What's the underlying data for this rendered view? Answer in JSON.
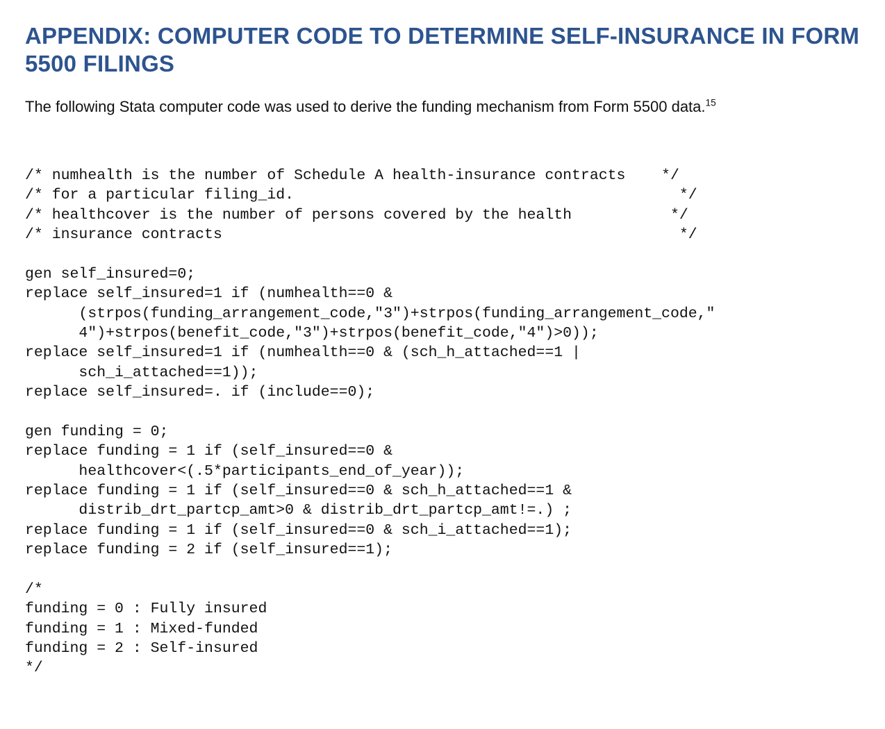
{
  "heading": "APPENDIX: COMPUTER CODE TO DETERMINE SELF-INSURANCE IN FORM 5500 FILINGS",
  "intro_text": "The following Stata computer code was used to derive the funding mechanism from Form 5500 data.",
  "footnote_marker": "15",
  "code_block": "/* numhealth is the number of Schedule A health-insurance contracts    */\n/* for a particular filing_id.                                           */\n/* healthcover is the number of persons covered by the health           */\n/* insurance contracts                                                   */\n\ngen self_insured=0;\nreplace self_insured=1 if (numhealth==0 &\n      (strpos(funding_arrangement_code,\"3\")+strpos(funding_arrangement_code,\"\n      4\")+strpos(benefit_code,\"3\")+strpos(benefit_code,\"4\")>0));\nreplace self_insured=1 if (numhealth==0 & (sch_h_attached==1 |\n      sch_i_attached==1));\nreplace self_insured=. if (include==0);\n\ngen funding = 0;\nreplace funding = 1 if (self_insured==0 &\n      healthcover<(.5*participants_end_of_year));\nreplace funding = 1 if (self_insured==0 & sch_h_attached==1 &\n      distrib_drt_partcp_amt>0 & distrib_drt_partcp_amt!=.) ;\nreplace funding = 1 if (self_insured==0 & sch_i_attached==1);\nreplace funding = 2 if (self_insured==1);\n\n/*\nfunding = 0 : Fully insured\nfunding = 1 : Mixed-funded\nfunding = 2 : Self-insured\n*/"
}
